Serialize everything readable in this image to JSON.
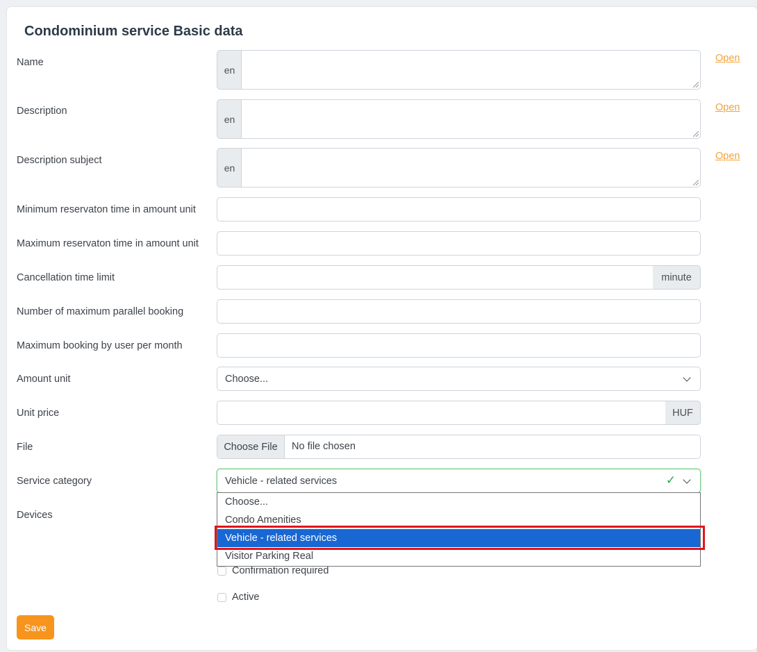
{
  "title": "Condominium service Basic data",
  "lang_prefix": "en",
  "open_link": "Open",
  "labels": {
    "name": "Name",
    "description": "Description",
    "description_subject": "Description subject",
    "min_reservation": "Minimum reservaton time in amount unit",
    "max_reservation": "Maximum reservaton time in amount unit",
    "cancellation": "Cancellation time limit",
    "parallel_booking": "Number of maximum parallel booking",
    "max_booking_user": "Maximum booking by user per month",
    "amount_unit": "Amount unit",
    "unit_price": "Unit price",
    "file": "File",
    "service_category": "Service category",
    "devices": "Devices"
  },
  "cancellation_suffix": "minute",
  "unit_price_suffix": "HUF",
  "amount_unit_value": "Choose...",
  "file_button": "Choose File",
  "file_status": "No file chosen",
  "service_category_value": "Vehicle - related services",
  "service_category_options": [
    "Choose...",
    "Condo Amenities",
    "Vehicle - related services",
    "Visitor Parking Real"
  ],
  "checkboxes": {
    "confirmation": "Confirmation required",
    "active": "Active"
  },
  "save_label": "Save"
}
